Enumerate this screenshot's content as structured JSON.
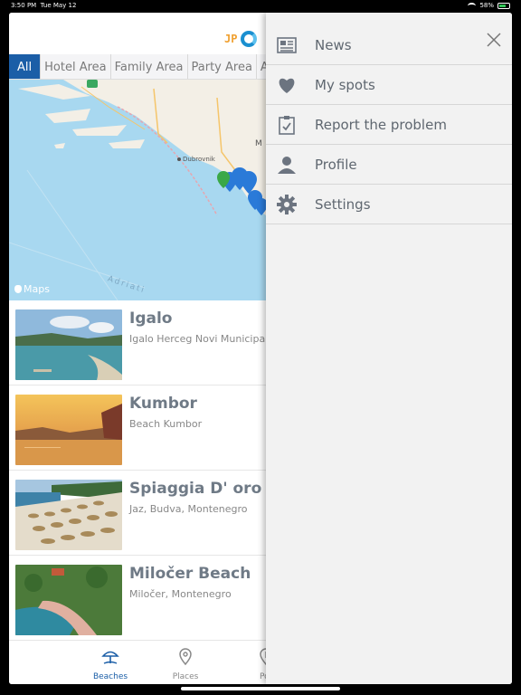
{
  "status_bar": {
    "time": "3:50 PM",
    "date": "Tue May 12",
    "battery": "58%"
  },
  "logo": {
    "text": "JP"
  },
  "tabs": [
    {
      "label": "All",
      "active": true
    },
    {
      "label": "Hotel Area",
      "active": false
    },
    {
      "label": "Family Area",
      "active": false
    },
    {
      "label": "Party Area",
      "active": false
    },
    {
      "label": "Active",
      "active": false
    }
  ],
  "map": {
    "credit": "Maps",
    "city_label": "Dubrovnik",
    "sea_label": "Adriati",
    "region_label": "M"
  },
  "beaches": [
    {
      "name": "Igalo",
      "location": "Igalo Herceg Novi Municipal"
    },
    {
      "name": "Kumbor",
      "location": "Beach Kumbor"
    },
    {
      "name": "Spiaggia D' oro",
      "location": "Jaz, Budva, Montenegro"
    },
    {
      "name": "Miločer Beach",
      "location": "Miločer, Montenegro"
    }
  ],
  "bottom_nav": [
    {
      "label": "Beaches",
      "icon": "beach-umbrella-icon",
      "active": true
    },
    {
      "label": "Places",
      "icon": "location-pin-icon",
      "active": false
    },
    {
      "label": "Port",
      "icon": "anchor-pin-icon",
      "active": false
    }
  ],
  "drawer": {
    "items": [
      {
        "label": "News",
        "icon": "newspaper-icon"
      },
      {
        "label": "My spots",
        "icon": "heart-icon"
      },
      {
        "label": "Report the problem",
        "icon": "clipboard-check-icon"
      },
      {
        "label": "Profile",
        "icon": "person-icon"
      },
      {
        "label": "Settings",
        "icon": "gear-icon"
      }
    ]
  },
  "colors": {
    "accent": "#1b5ea7",
    "drawer_bg": "#f2f2f2",
    "text_gray": "#5f6770"
  }
}
